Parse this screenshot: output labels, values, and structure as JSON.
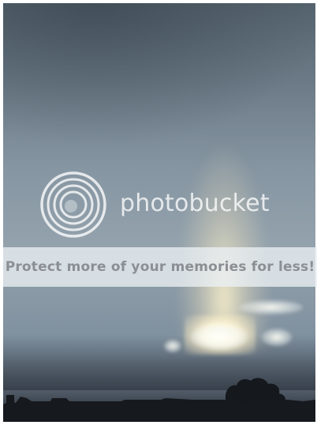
{
  "image": {
    "subject": "sky-photo"
  },
  "watermark": {
    "brand": "photobucket"
  },
  "promo_band": {
    "text": "Protect more of your memories for less!"
  },
  "colors": {
    "sky": "#8696a2",
    "sun": "#fff8df",
    "skyline": "#16191e",
    "band": "#ebf0f4",
    "band_text": "#8b8f94"
  }
}
